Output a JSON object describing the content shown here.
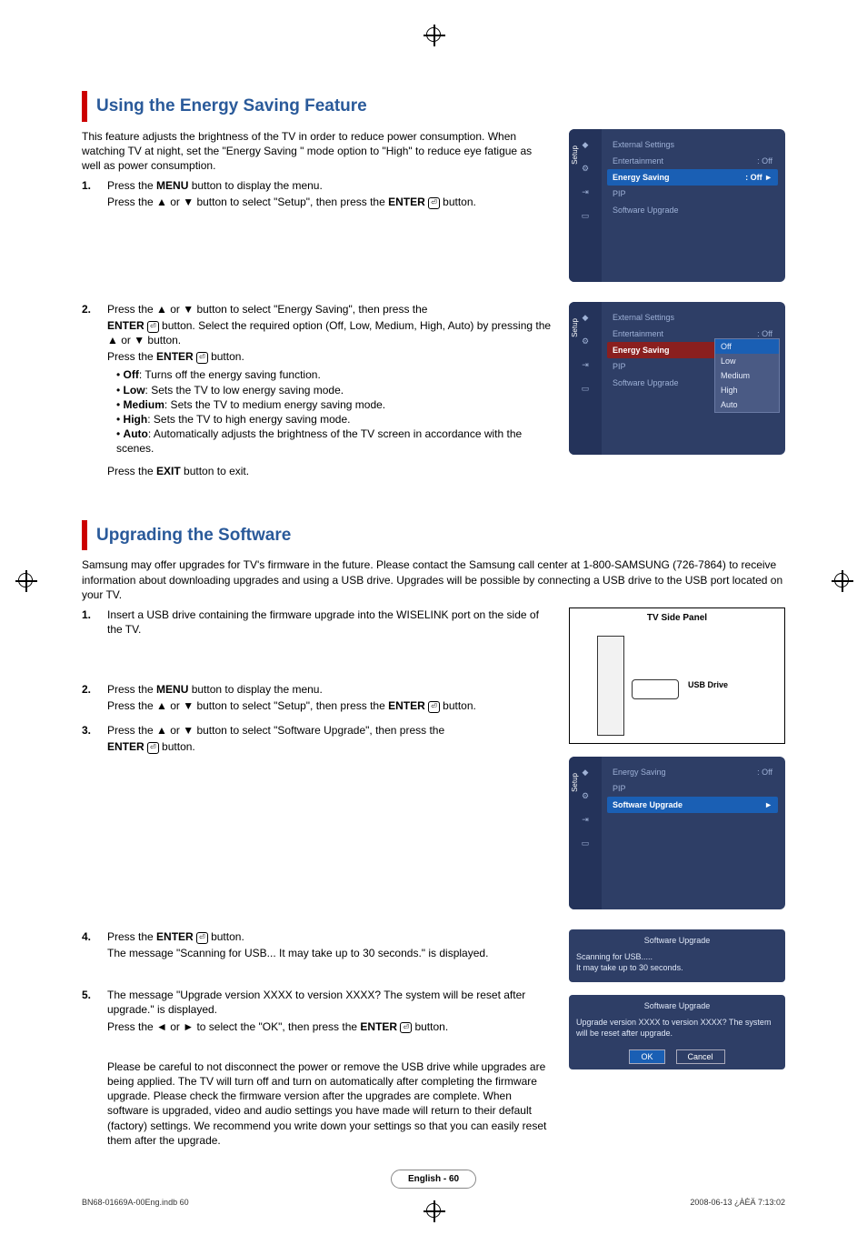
{
  "section1": {
    "title": "Using the Energy Saving Feature",
    "intro": "This feature adjusts the brightness of the TV in order to reduce power consumption. When watching TV at night, set the \"Energy Saving \" mode option to \"High\" to reduce eye fatigue as well as power consumption.",
    "step1a": "Press the ",
    "step1a_bold": "MENU",
    "step1a_end": " button to display the menu.",
    "step1b": "Press the ▲ or ▼ button to select \"Setup\", then press the ",
    "step1b_bold": "ENTER",
    "step1b_end": " button.",
    "step2a": "Press the ▲ or ▼ button to select \"Energy Saving\", then press the",
    "step2b_bold": "ENTER",
    "step2b": " button. Select the required option (Off, Low, Medium, High, Auto) by pressing the ▲ or ▼ button.",
    "step2c": "Press the ",
    "step2c_bold": "ENTER",
    "step2c_end": " button.",
    "opt_off": "Off",
    "opt_off_desc": ": Turns off the energy saving function.",
    "opt_low": "Low",
    "opt_low_desc": ": Sets the TV to low energy saving mode.",
    "opt_med": "Medium",
    "opt_med_desc": ": Sets the TV to medium energy saving mode.",
    "opt_high": "High",
    "opt_high_desc": ": Sets the TV to high energy saving mode.",
    "opt_auto": "Auto",
    "opt_auto_desc": ": Automatically adjusts the brightness of the TV screen in accordance with the scenes.",
    "exit": "Press the ",
    "exit_bold": "EXIT",
    "exit_end": " button to exit."
  },
  "osd1": {
    "sidebar_label": "Setup",
    "items": [
      {
        "label": "External Settings",
        "val": ""
      },
      {
        "label": "Entertainment",
        "val": ": Off"
      },
      {
        "label": "Energy Saving",
        "val": ": Off",
        "sel": true,
        "arrow": "►"
      },
      {
        "label": "PIP",
        "val": ""
      },
      {
        "label": "Software Upgrade",
        "val": ""
      }
    ]
  },
  "osd2": {
    "sidebar_label": "Setup",
    "items": [
      {
        "label": "External Settings",
        "val": ""
      },
      {
        "label": "Entertainment",
        "val": ": Off"
      },
      {
        "label": "Energy Saving",
        "val": "",
        "selred": true
      },
      {
        "label": "PIP",
        "val": ""
      },
      {
        "label": "Software Upgrade",
        "val": ""
      }
    ],
    "submenu": [
      "Off",
      "Low",
      "Medium",
      "High",
      "Auto"
    ]
  },
  "section2": {
    "title": "Upgrading the Software",
    "intro": "Samsung may offer upgrades for TV's firmware in the future. Please contact the Samsung call center at 1-800-SAMSUNG (726-7864) to receive information about downloading upgrades and using a USB drive. Upgrades will be possible by connecting a USB drive to the USB port located on your TV.",
    "step1": "Insert a USB drive containing the firmware upgrade into the WISELINK port on the side of the TV.",
    "step2a": "Press the ",
    "step2a_bold": "MENU",
    "step2a_end": " button to display the menu.",
    "step2b": "Press the ▲ or ▼ button to select \"Setup\", then press the ",
    "step2b_bold": "ENTER",
    "step2b_end": " button.",
    "step3a": "Press the ▲ or ▼ button to select \"Software Upgrade\", then press the",
    "step3b_bold": "ENTER",
    "step3b_end": " button.",
    "step4a": "Press the ",
    "step4a_bold": "ENTER",
    "step4a_end": " button.",
    "step4b": "The message \"Scanning for USB... It may take up to 30 seconds.\" is displayed.",
    "step5a": "The message \"Upgrade version XXXX to version XXXX? The system will be reset after upgrade.\" is displayed.",
    "step5b": "Press the ◄ or ► to select the \"OK\", then press the ",
    "step5b_bold": "ENTER",
    "step5b_end": " button.",
    "warn": "Please be careful to not disconnect the power or remove the USB drive while upgrades are being applied. The TV will turn off and turn on automatically after completing the firmware upgrade. Please check the firmware version after the upgrades are complete. When software is upgraded, video and audio settings you have made will return to their default (factory) settings. We recommend you write down your settings so that you can easily reset them after the upgrade."
  },
  "tvfig": {
    "title": "TV Side Panel",
    "usb_label": "USB Drive"
  },
  "osd3": {
    "sidebar_label": "Setup",
    "items": [
      {
        "label": "Energy Saving",
        "val": ": Off"
      },
      {
        "label": "PIP",
        "val": ""
      },
      {
        "label": "Software Upgrade",
        "val": "",
        "sel": true,
        "arrow": "►"
      }
    ]
  },
  "dlg1": {
    "title": "Software Upgrade",
    "body1": "Scanning for USB.....",
    "body2": "It may take up to 30 seconds."
  },
  "dlg2": {
    "title": "Software Upgrade",
    "body": "Upgrade version XXXX to version XXXX? The system will be reset after upgrade.",
    "ok": "OK",
    "cancel": "Cancel"
  },
  "footer": {
    "page": "English - 60",
    "docfile": "BN68-01669A-00Eng.indb   60",
    "timestamp": "2008-06-13   ¿ÀÈÄ 7:13:02"
  }
}
